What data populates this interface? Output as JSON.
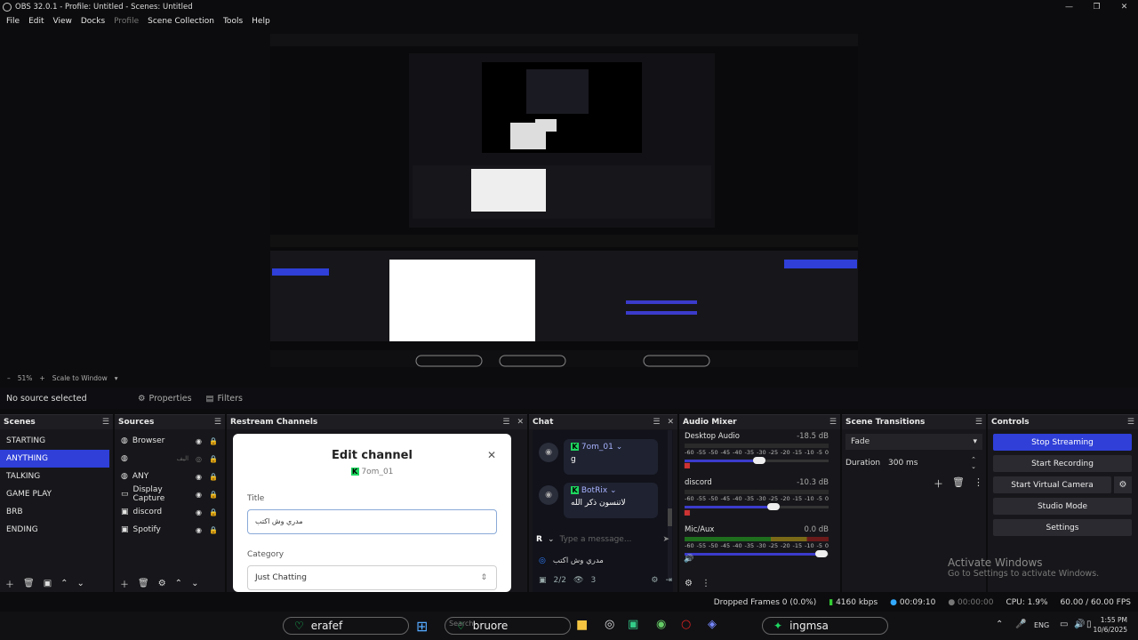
{
  "window": {
    "title": "OBS 32.0.1 - Profile: Untitled - Scenes: Untitled",
    "min": "—",
    "max": "❐",
    "close": "✕"
  },
  "menu": [
    "File",
    "Edit",
    "View",
    "Docks",
    "Profile",
    "Scene Collection",
    "Tools",
    "Help"
  ],
  "zoom": {
    "minus": "–",
    "value": "51%",
    "plus": "+",
    "mode": "Scale to Window"
  },
  "source_bar": {
    "no_source": "No source selected",
    "properties": "Properties",
    "filters": "Filters"
  },
  "scenes": {
    "title": "Scenes",
    "items": [
      "STARTING",
      "ANYTHING",
      "TALKING",
      "GAME PLAY",
      "BRB",
      "ENDING"
    ],
    "selected": 1
  },
  "sources": {
    "title": "Sources",
    "items": [
      "Browser",
      "",
      "ANY",
      "Display Capture",
      "discord",
      "Spotify"
    ],
    "tooltip_text": "اليف"
  },
  "restream": {
    "title": "Restream Channels",
    "modal": {
      "title": "Edit channel",
      "channel": "7om_01",
      "title_label": "Title",
      "title_value": "مدري وش اكتب",
      "category_label": "Category",
      "category_value": "Just Chatting"
    }
  },
  "chat": {
    "title": "Chat",
    "messages": [
      {
        "name": "7om_01",
        "text": "g"
      },
      {
        "name": "BotRix",
        "text": "لاتنسون ذكر الله"
      }
    ],
    "input_placeholder": "Type a message...",
    "platform_r": "R",
    "now_title": "مدري وش اكتب",
    "count_a": "2/2",
    "count_b": "3"
  },
  "mixer": {
    "title": "Audio Mixer",
    "channels": [
      {
        "name": "Desktop Audio",
        "db": "-18.5 dB",
        "level": 0.52
      },
      {
        "name": "discord",
        "db": "-10.3 dB",
        "level": 0.62
      },
      {
        "name": "Mic/Aux",
        "db": "0.0 dB",
        "level": 0.95
      }
    ],
    "scale": [
      "-60",
      "-55",
      "-50",
      "-45",
      "-40",
      "-35",
      "-30",
      "-25",
      "-20",
      "-15",
      "-10",
      "-5",
      "0"
    ]
  },
  "transitions": {
    "title": "Scene Transitions",
    "selected": "Fade",
    "duration_label": "Duration",
    "duration_value": "300 ms"
  },
  "controls": {
    "title": "Controls",
    "buttons": [
      "Stop Streaming",
      "Start Recording",
      "Start Virtual Camera",
      "Studio Mode",
      "Settings"
    ]
  },
  "watermark": {
    "line1": "Activate Windows",
    "line2": "Go to Settings to activate Windows."
  },
  "status": {
    "dropped": "Dropped Frames 0 (0.0%)",
    "kbps": "4160 kbps",
    "stream_time": "00:09:10",
    "rec_time": "00:00:00",
    "cpu": "CPU: 1.9%",
    "fps": "60.00 / 60.00 FPS"
  },
  "taskbar": {
    "pill1": "erafef",
    "pill2": "bruore",
    "pill3": "ingmsa",
    "search": "Search",
    "lang": "ENG",
    "time": "1:55 PM",
    "date": "10/6/2025"
  },
  "colors": {
    "accent": "#2f3fd8",
    "kick": "#1ed760",
    "panel": "#17171b"
  }
}
